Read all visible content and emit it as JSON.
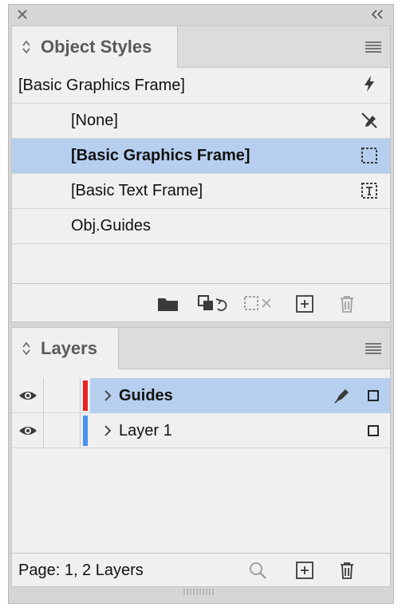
{
  "object_styles": {
    "tab_title": "Object Styles",
    "current_style": "[Basic Graphics Frame]",
    "items": [
      {
        "label": "[None]"
      },
      {
        "label": "[Basic Graphics Frame]"
      },
      {
        "label": "[Basic Text Frame]"
      },
      {
        "label": "Obj.Guides"
      }
    ]
  },
  "layers": {
    "tab_title": "Layers",
    "items": [
      {
        "label": "Guides",
        "color": "#e8201f"
      },
      {
        "label": "Layer 1",
        "color": "#4a90f0"
      }
    ],
    "status": "Page: 1, 2 Layers"
  },
  "colors": {
    "selection": "#b6cfee",
    "panel_bg": "#f0f0f0",
    "icon": "#3a3a3a",
    "icon_disabled": "#a0a0a0"
  }
}
